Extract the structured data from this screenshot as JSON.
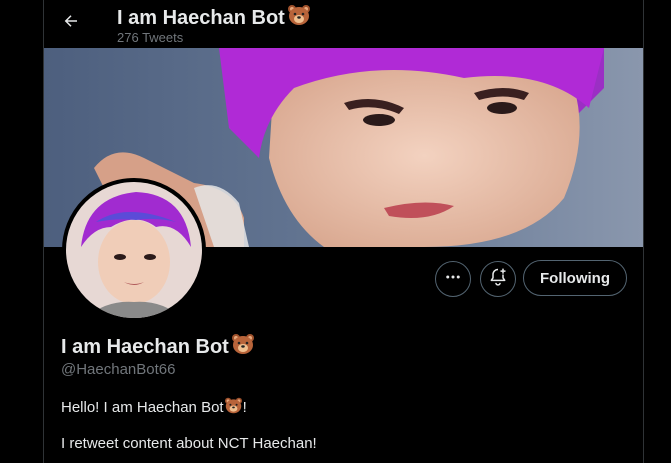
{
  "header": {
    "title": "I am Haechan Bot",
    "tweet_count": "276 Tweets",
    "back_icon": "arrow-left-icon"
  },
  "banner": {
    "description_icon": "banner-image"
  },
  "profile": {
    "display_name": "I am Haechan Bot",
    "name_emoji": "bear-face-icon",
    "handle": "@HaechanBot66",
    "bio_line1_prefix": "Hello! I am Haechan Bot",
    "bio_line1_suffix": "!",
    "bio_line2": "I retweet content about NCT Haechan!"
  },
  "actions": {
    "more_icon": "more-icon",
    "notify_icon": "bell-plus-icon",
    "follow_label": "Following"
  },
  "colors": {
    "background": "#000000",
    "text": "#e7e9ea",
    "secondary_text": "#71767b",
    "border": "#536471",
    "hair_accent": "#b02ad6"
  }
}
